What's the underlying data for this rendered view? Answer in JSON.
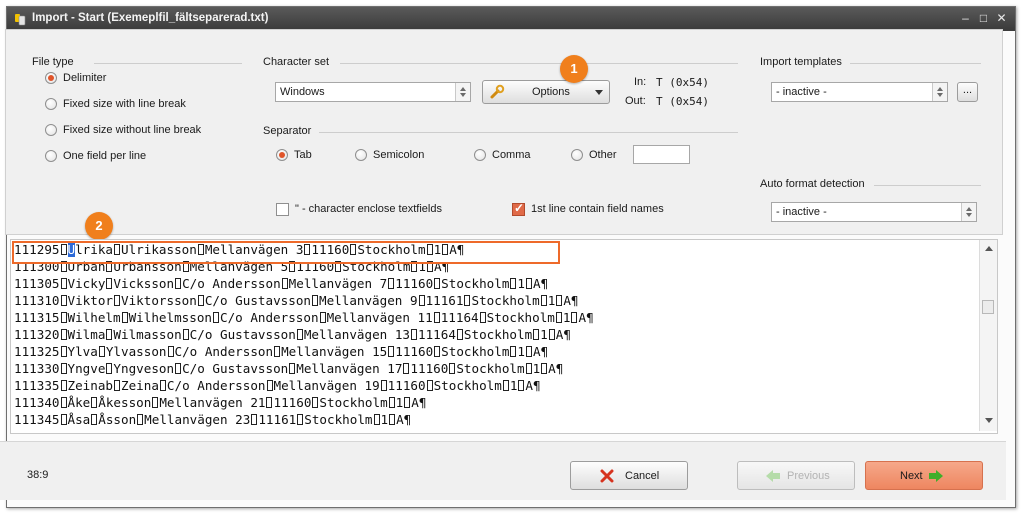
{
  "window": {
    "title": "Import - Start  (Exemeplfil_fältseparerad.txt)"
  },
  "file_type": {
    "heading": "File type",
    "options": [
      {
        "label": "Delimiter",
        "selected": true
      },
      {
        "label": "Fixed size with line break",
        "selected": false
      },
      {
        "label": "Fixed size without line break",
        "selected": false
      },
      {
        "label": "One field per line",
        "selected": false
      }
    ]
  },
  "charset": {
    "heading": "Character set",
    "value": "Windows",
    "options_button": "Options",
    "in_label": "In:",
    "in_value": "T (0x54)",
    "out_label": "Out:",
    "out_value": "T (0x54)"
  },
  "separator": {
    "heading": "Separator",
    "options": [
      {
        "label": "Tab",
        "selected": true
      },
      {
        "label": "Semicolon",
        "selected": false
      },
      {
        "label": "Comma",
        "selected": false
      },
      {
        "label": "Other",
        "selected": false
      }
    ],
    "other_value": ""
  },
  "checkboxes": {
    "quote_label": "\" - character enclose textfields",
    "quote_checked": false,
    "first_line_label": "1st line contain field names",
    "first_line_checked": true
  },
  "import_templates": {
    "heading": "Import templates",
    "value": "- inactive -",
    "browse_button": "..."
  },
  "auto_format": {
    "heading": "Auto format detection",
    "value": "- inactive -"
  },
  "badges": {
    "one": "1",
    "two": "2"
  },
  "preview": {
    "rows": [
      [
        "111295",
        "Ulrika",
        "Ulrikasson",
        "Mellanvägen 3",
        "11160",
        "Stockholm",
        "1",
        "A¶"
      ],
      [
        "111300",
        "Urban",
        "Urbansson",
        "Mellanvägen 5",
        "11160",
        "Stockholm",
        "1",
        "A¶"
      ],
      [
        "111305",
        "Vicky",
        "Vicksson",
        "C/o Andersson",
        "Mellanvägen 7",
        "11160",
        "Stockholm",
        "1",
        "A¶"
      ],
      [
        "111310",
        "Viktor",
        "Viktorsson",
        "C/o Gustavsson",
        "Mellanvägen 9",
        "11161",
        "Stockholm",
        "1",
        "A¶"
      ],
      [
        "111315",
        "Wilhelm",
        "Wilhelmsson",
        "C/o Andersson",
        "Mellanvägen 11",
        "11164",
        "Stockholm",
        "1",
        "A¶"
      ],
      [
        "111320",
        "Wilma",
        "Wilmasson",
        "C/o Gustavsson",
        "Mellanvägen 13",
        "11164",
        "Stockholm",
        "1",
        "A¶"
      ],
      [
        "111325",
        "Ylva",
        "Ylvasson",
        "C/o Andersson",
        "Mellanvägen 15",
        "11160",
        "Stockholm",
        "1",
        "A¶"
      ],
      [
        "111330",
        "Yngve",
        "Yngveson",
        "C/o Gustavsson",
        "Mellanvägen 17",
        "11160",
        "Stockholm",
        "1",
        "A¶"
      ],
      [
        "111335",
        "Zeinab",
        "Zeina",
        "C/o Andersson",
        "Mellanvägen 19",
        "11160",
        "Stockholm",
        "1",
        "A¶"
      ],
      [
        "111340",
        "Åke",
        "Åkesson",
        "Mellanvägen 21",
        "11160",
        "Stockholm",
        "1",
        "A¶"
      ],
      [
        "111345",
        "Åsa",
        "Åsson",
        "Mellanvägen 23",
        "11161",
        "Stockholm",
        "1",
        "A¶"
      ]
    ]
  },
  "footer": {
    "cursor_position": "38:9",
    "cancel_label": "Cancel",
    "previous_label": "Previous",
    "next_label": "Next"
  },
  "colors": {
    "accent": "#f07f1c",
    "highlight_border": "#ee6a2a",
    "next_button": "#f0906e",
    "title_bar": "#444444"
  }
}
